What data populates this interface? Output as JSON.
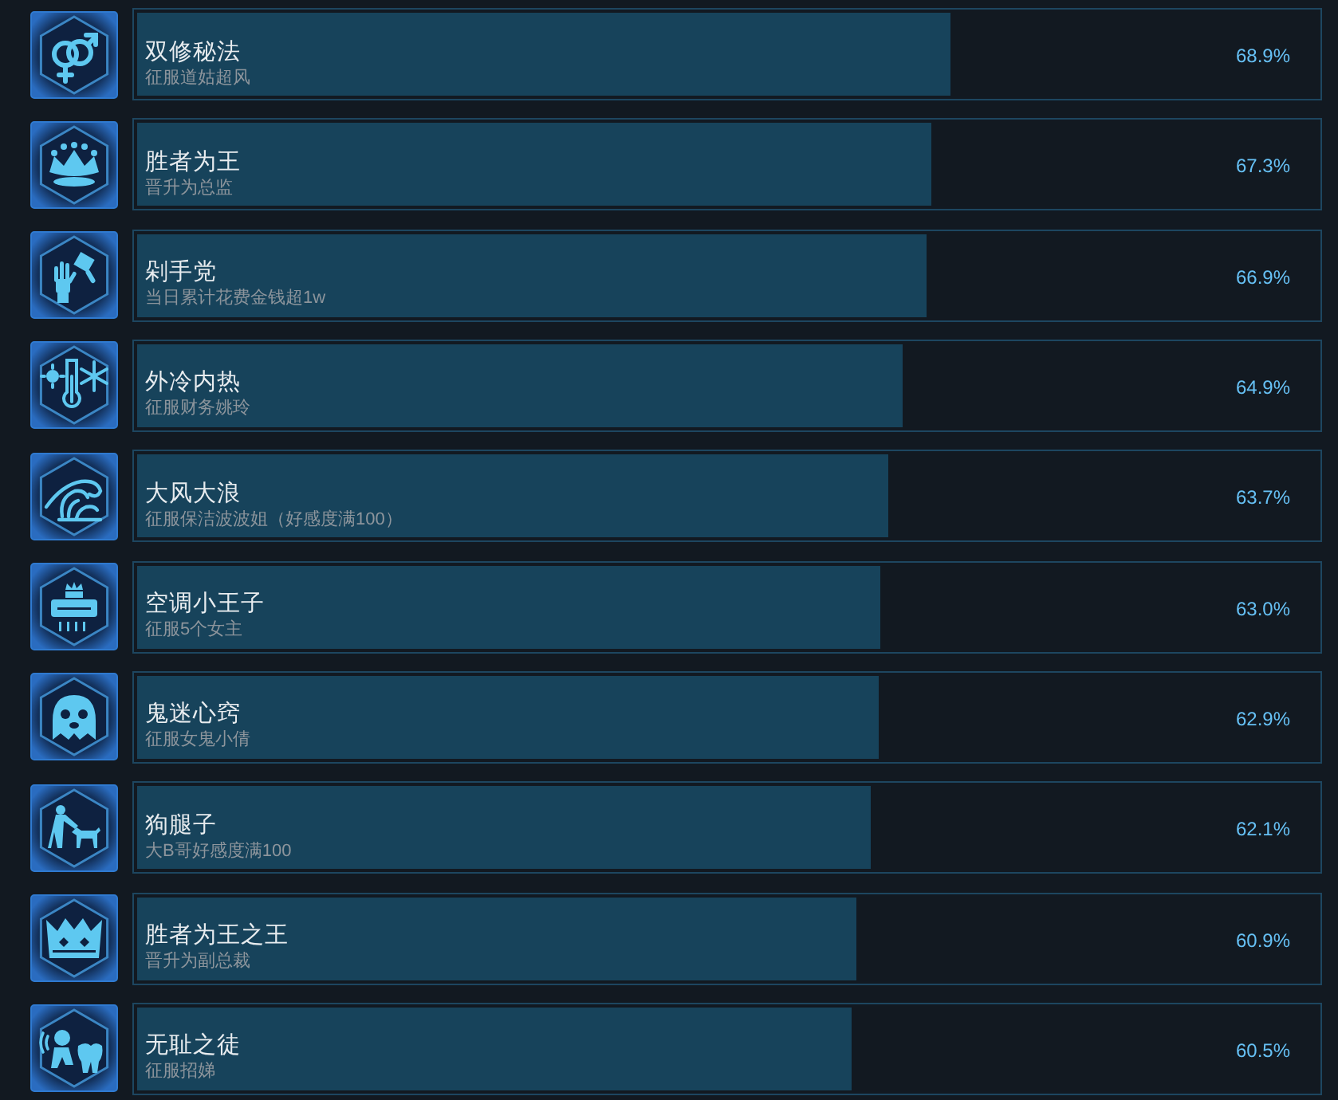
{
  "achievements": [
    {
      "title": "双修秘法",
      "description": "征服道姑超风",
      "level": 0.689,
      "percent": "68.9%"
    },
    {
      "title": "胜者为王",
      "description": "晋升为总监",
      "level": 0.673,
      "percent": "67.3%"
    },
    {
      "title": "剁手党",
      "description": "当日累计花费金钱超1w",
      "level": 0.669,
      "percent": "66.9%"
    },
    {
      "title": "外冷内热",
      "description": "征服财务姚玲",
      "level": 0.649,
      "percent": "64.9%"
    },
    {
      "title": "大风大浪",
      "description": "征服保洁波波姐（好感度满100）",
      "level": 0.637,
      "percent": "63.7%"
    },
    {
      "title": "空调小王子",
      "description": "征服5个女主",
      "level": 0.63,
      "percent": "63.0%"
    },
    {
      "title": "鬼迷心窍",
      "description": "征服女鬼小倩",
      "level": 0.629,
      "percent": "62.9%"
    },
    {
      "title": "狗腿子",
      "description": "大B哥好感度满100",
      "level": 0.621,
      "percent": "62.1%"
    },
    {
      "title": "胜者为王之王",
      "description": "晋升为副总裁",
      "level": 0.609,
      "percent": "60.9%"
    },
    {
      "title": "无耻之徒",
      "description": "征服招娣",
      "level": 0.605,
      "percent": "60.5%"
    }
  ]
}
